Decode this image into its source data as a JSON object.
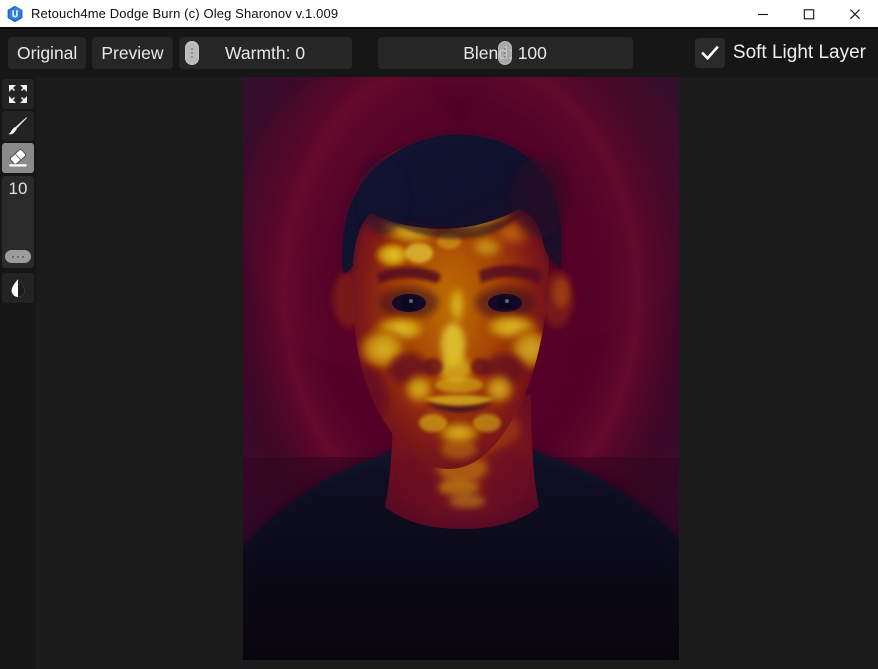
{
  "window": {
    "title": "Retouch4me Dodge Burn (c) Oleg Sharonov v.1.009",
    "app_icon": "retouch4me-hexagon-icon",
    "controls": {
      "minimize": "minimize-icon",
      "maximize": "maximize-icon",
      "close": "close-icon"
    }
  },
  "toolbar": {
    "original_label": "Original",
    "preview_label": "Preview",
    "warmth": {
      "label": "Warmth: 0",
      "name": "Warmth",
      "value": 0,
      "handle_position_percent": 0
    },
    "blend": {
      "label": "Blend: 100",
      "name": "Blend",
      "value": 100,
      "handle_position_percent": 48
    },
    "soft_light_layer": {
      "label": "Soft Light Layer",
      "checked": true,
      "check_icon": "checkmark-icon"
    }
  },
  "tools": {
    "items": [
      {
        "name": "fit-to-screen",
        "icon": "expand-arrows-icon",
        "selected": false
      },
      {
        "name": "brush",
        "icon": "paintbrush-icon",
        "selected": false
      },
      {
        "name": "eraser",
        "icon": "eraser-icon",
        "selected": true
      }
    ],
    "brush_size": {
      "label": "10",
      "value": 10,
      "handle_position_percent": 8
    },
    "contrast": {
      "name": "contrast",
      "icon": "droplet-contrast-icon",
      "selected": false
    }
  },
  "canvas": {
    "image_name": "dodge-burn-heatmap-portrait",
    "description": "Portrait rendered as a dodge & burn heatmap overlay",
    "colors": {
      "background": "#4d0024",
      "background_edge": "#2e0a2e",
      "hair": "#12122e",
      "skin_mid": "#a33000",
      "skin_highlight": "#f5d312",
      "shirt": "#07070f"
    }
  },
  "palette": {
    "titlebar_bg": "#ffffff",
    "titlebar_text": "#101010",
    "toolbar_bg": "#161616",
    "control_bg": "#262626",
    "workspace_bg": "#1b1b1b",
    "text": "#e8e8e8",
    "selected_tool_bg": "#8a8a8a",
    "slider_handle": "#b9b9b9"
  }
}
